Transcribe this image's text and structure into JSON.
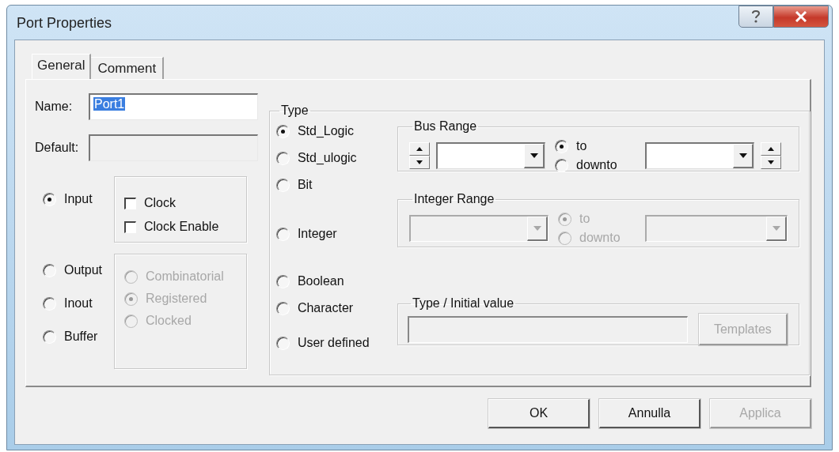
{
  "window": {
    "title": "Port Properties"
  },
  "tabs": [
    {
      "label": "General",
      "selected": true
    },
    {
      "label": "Comment",
      "selected": false
    }
  ],
  "general": {
    "name": {
      "label": "Name:",
      "value": "Port1",
      "highlighted": true
    },
    "default": {
      "label": "Default:"
    },
    "directions": [
      {
        "label": "Input",
        "selected": true
      },
      {
        "label": "Output",
        "selected": false
      },
      {
        "label": "Inout",
        "selected": false
      },
      {
        "label": "Buffer",
        "selected": false
      }
    ],
    "clock_options": [
      {
        "label": "Clock",
        "checked": false
      },
      {
        "label": "Clock Enable",
        "checked": false
      }
    ],
    "output_modes": [
      {
        "label": "Combinatorial",
        "selected": false,
        "disabled": true
      },
      {
        "label": "Registered",
        "selected": true,
        "disabled": true
      },
      {
        "label": "Clocked",
        "selected": false,
        "disabled": true
      }
    ],
    "type": {
      "title": "Type",
      "options": [
        {
          "label": "Std_Logic",
          "selected": true
        },
        {
          "label": "Std_ulogic",
          "selected": false
        },
        {
          "label": "Bit",
          "selected": false
        },
        {
          "label": "Integer",
          "selected": false
        },
        {
          "label": "Boolean",
          "selected": false
        },
        {
          "label": "Character",
          "selected": false
        },
        {
          "label": "User defined",
          "selected": false
        }
      ]
    },
    "bus_range": {
      "title": "Bus Range",
      "directions": [
        {
          "label": "to",
          "selected": true
        },
        {
          "label": "downto",
          "selected": false
        }
      ]
    },
    "integer_range": {
      "title": "Integer Range",
      "disabled": true,
      "directions": [
        {
          "label": "to",
          "selected": true
        },
        {
          "label": "downto",
          "selected": false
        }
      ]
    },
    "initial_value": {
      "title": "Type / Initial value",
      "disabled": true,
      "button": "Templates"
    }
  },
  "buttons": [
    {
      "label": "OK",
      "disabled": false
    },
    {
      "label": "Annulla",
      "disabled": false
    },
    {
      "label": "Applica",
      "disabled": true
    }
  ]
}
